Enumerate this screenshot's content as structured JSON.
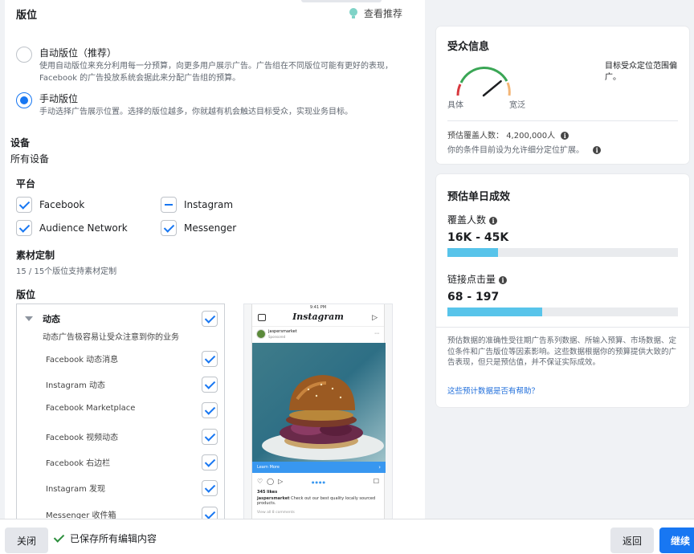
{
  "placements": {
    "section_title": "版位",
    "recommend_label": "查看推荐",
    "auto": {
      "title": "自动版位（推荐）",
      "desc": "使用自动版位来充分利用每一分预算，向更多用户展示广告。广告组在不同版位可能有更好的表现，Facebook 的广告投放系统会据此来分配广告组的预算。",
      "selected": false
    },
    "manual": {
      "title": "手动版位",
      "desc": "手动选择广告展示位置。选择的版位越多，你就越有机会触达目标受众，实现业务目标。",
      "selected": true
    }
  },
  "devices": {
    "title": "设备",
    "value": "所有设备"
  },
  "platforms": {
    "title": "平台",
    "items": [
      {
        "label": "Facebook",
        "state": "checked"
      },
      {
        "label": "Instagram",
        "state": "partial"
      },
      {
        "label": "Audience Network",
        "state": "checked"
      },
      {
        "label": "Messenger",
        "state": "checked"
      }
    ]
  },
  "asset_customization": {
    "title": "素材定制",
    "desc": "15 / 15个版位支持素材定制"
  },
  "placement_list": {
    "title": "版位",
    "group": {
      "label": "动态",
      "desc": "动态广告极容易让受众注意到你的业务",
      "checked": true
    },
    "items": [
      {
        "label": "Facebook 动态消息",
        "checked": true
      },
      {
        "label": "Instagram 动态",
        "checked": true
      },
      {
        "label": "Facebook Marketplace",
        "checked": true
      },
      {
        "label": "Facebook 视频动态",
        "checked": true
      },
      {
        "label": "Facebook 右边栏",
        "checked": true
      },
      {
        "label": "Instagram 发现",
        "checked": true
      },
      {
        "label": "Messenger 收件箱",
        "checked": true
      }
    ]
  },
  "preview": {
    "time": "9:41 PM",
    "app_logo": "Instagram",
    "account": "jaspersmarket",
    "sponsored": "Sponsored",
    "cta": "Learn More",
    "likes": "345 likes",
    "caption_user": "jaspersmarket",
    "caption": "Check out our best quality locally sourced products.",
    "comments": "View all 8 comments"
  },
  "audience": {
    "title": "受众信息",
    "gauge_left": "具体",
    "gauge_right": "宽泛",
    "gauge_level": 0.78,
    "desc": "目标受众定位范围偏广。",
    "reach_label": "预估覆盖人数：",
    "reach_value": "4,200,000人",
    "note": "你的条件目前设为允许细分定位扩展。"
  },
  "daily_results": {
    "title": "预估单日成效",
    "reach": {
      "label": "覆盖人数",
      "value": "16K - 45K",
      "fill": 0.22
    },
    "clicks": {
      "label": "链接点击量",
      "value": "68 - 197",
      "fill": 0.41
    },
    "disclaimer": "预估数据的准确性受往期广告系列数据、所输入预算、市场数据、定位条件和广告版位等因素影响。这些数据根据你的预算提供大致的广告表现，但只是预估值，并不保证实际成效。",
    "help_link": "这些预计数据是否有帮助？"
  },
  "footer": {
    "close_label": "关闭",
    "saved_label": "已保存所有编辑内容",
    "back_label": "返回",
    "continue_label": "继续"
  },
  "colors": {
    "accent": "#1877f2",
    "bar_fill": "#58c4ea",
    "saved_check": "#2d8f3d"
  }
}
